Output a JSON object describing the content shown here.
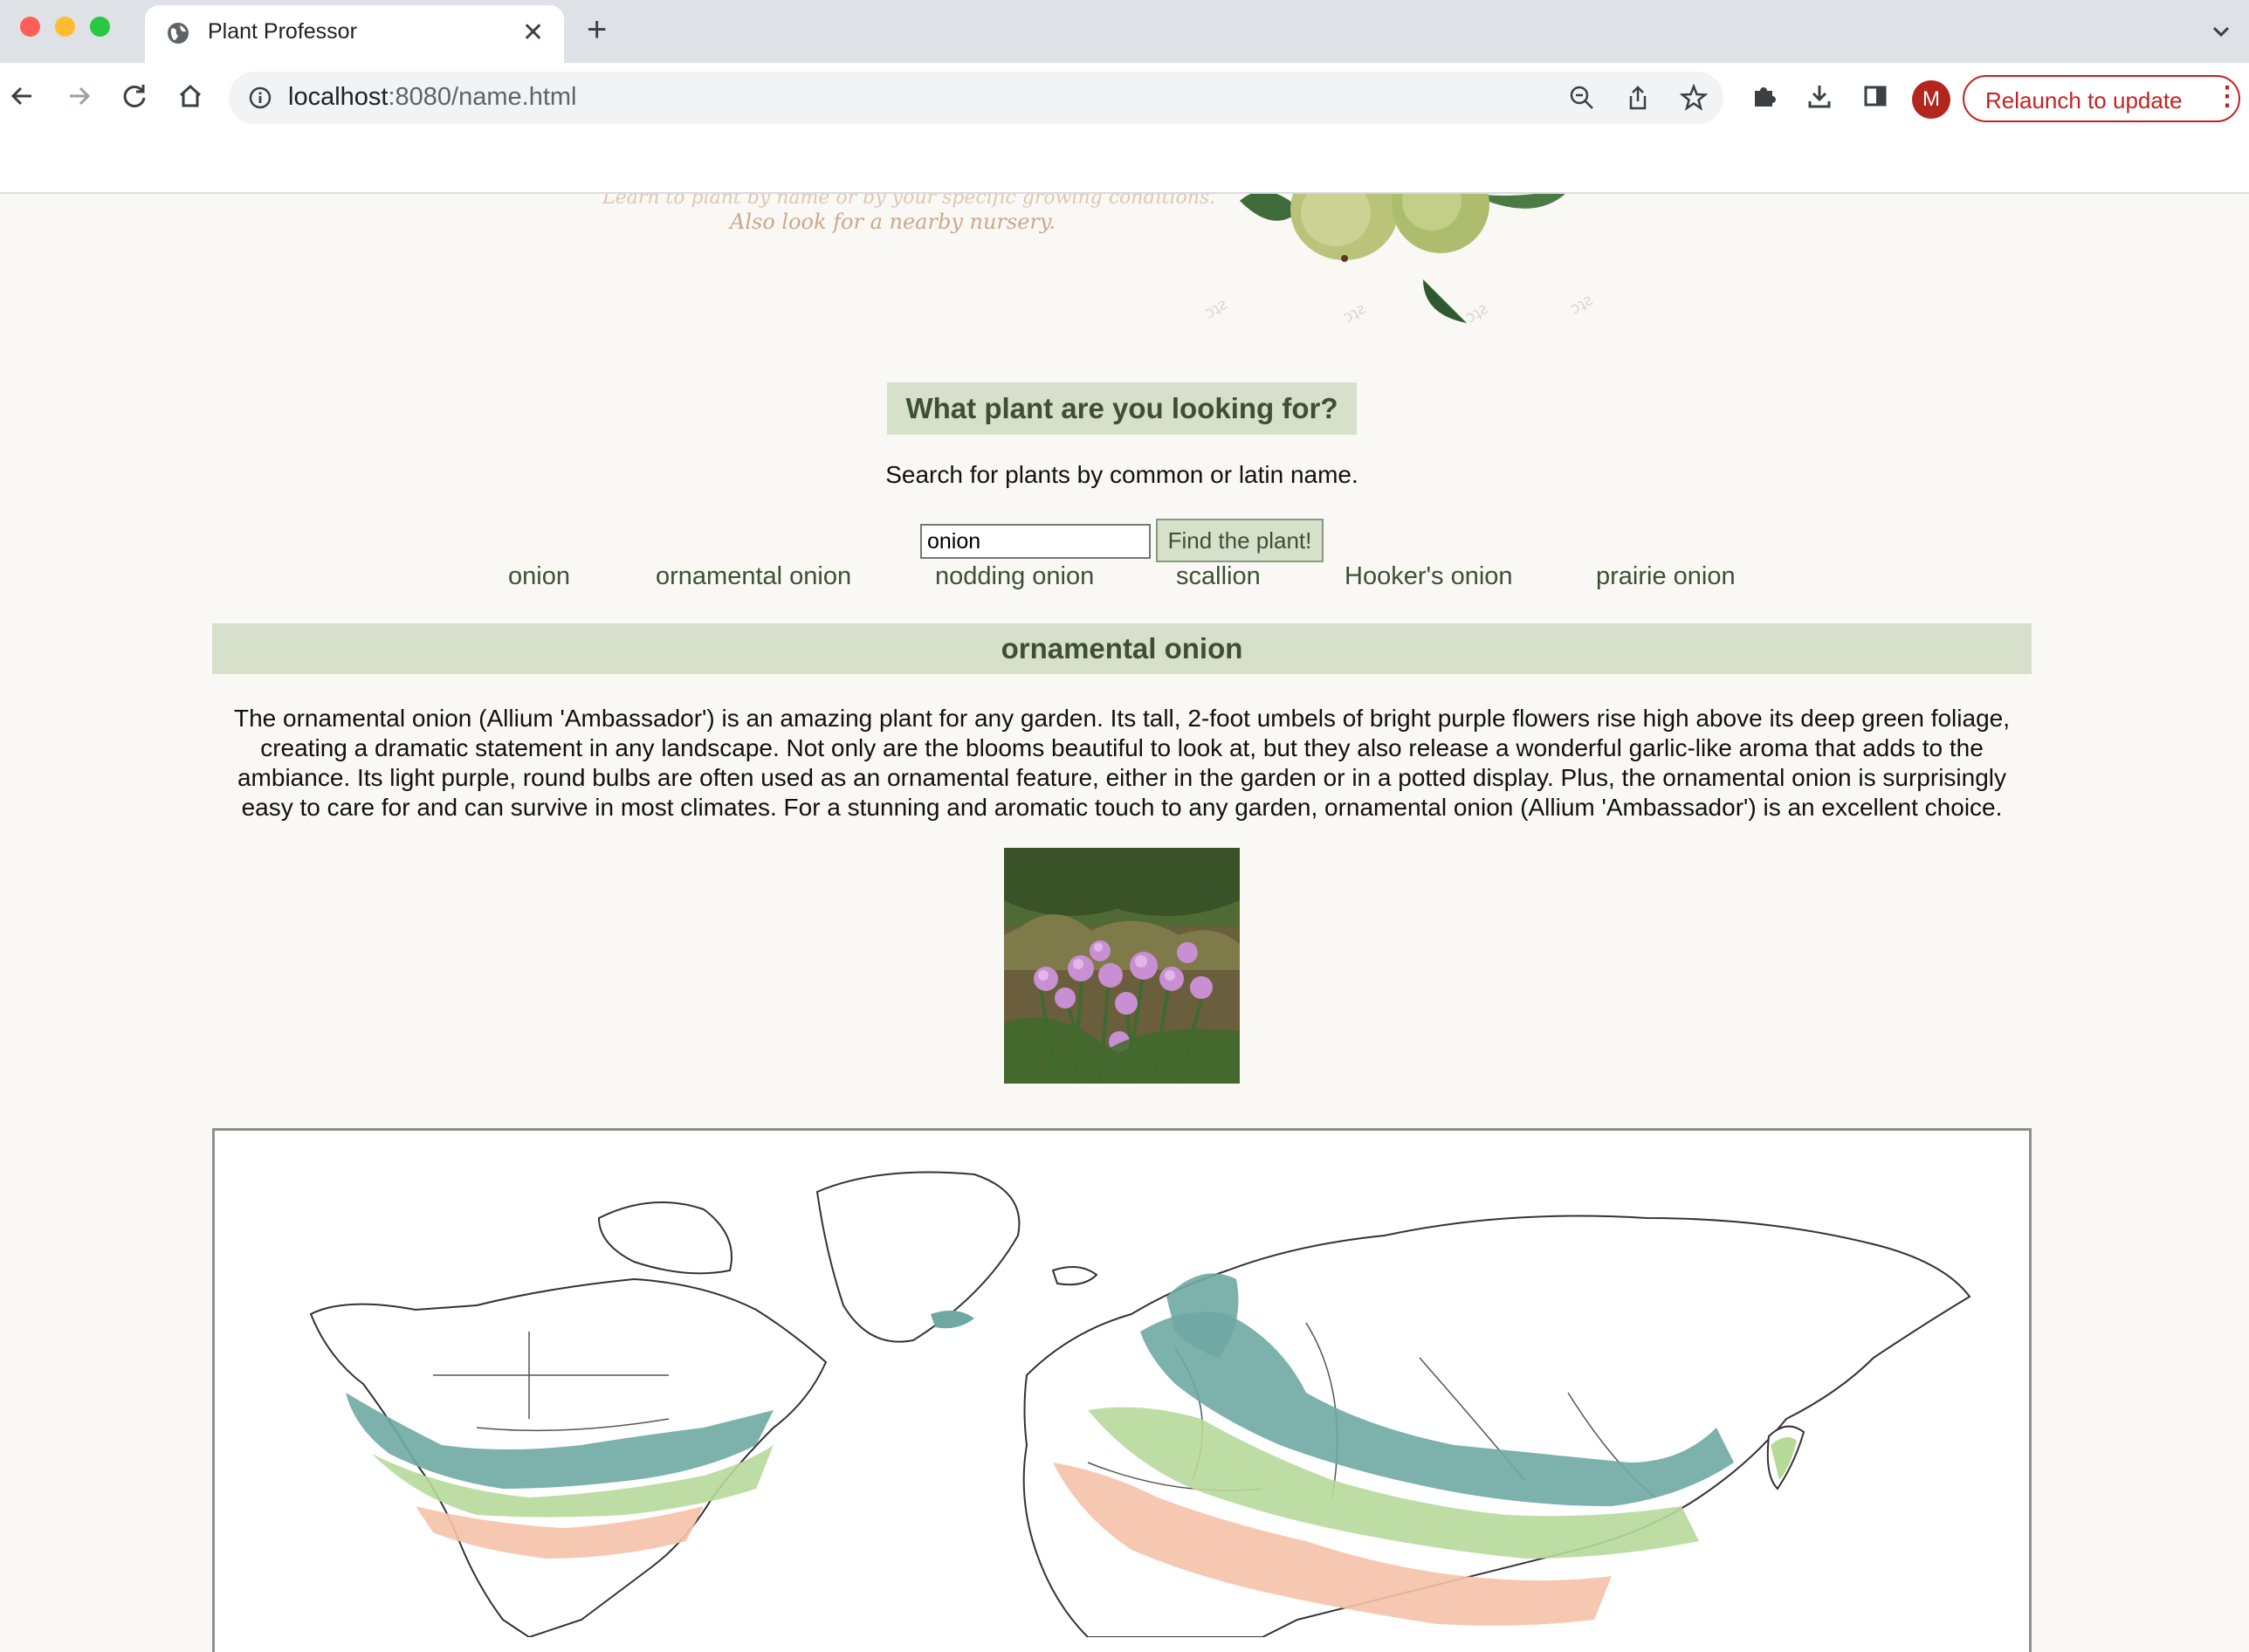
{
  "browser": {
    "tab_title": "Plant Professor",
    "url_host": "localhost",
    "url_rest": ":8080/name.html",
    "profile_initial": "M",
    "relaunch_label": "Relaunch to update"
  },
  "hero": {
    "tagline_partial": "Learn to plant by name or by your specific growing conditions.",
    "tagline_nursery": "Also look for a nearby nursery."
  },
  "search": {
    "question": "What plant are you looking for?",
    "instructions": "Search for plants by common or latin name.",
    "query": "onion",
    "button_label": "Find the plant!",
    "results": [
      "onion",
      "ornamental onion",
      "nodding onion",
      "scallion",
      "Hooker's onion",
      "prairie onion"
    ]
  },
  "plant": {
    "name": "ornamental onion",
    "description": "The ornamental onion (Allium 'Ambassador') is an amazing plant for any garden. Its tall, 2-foot umbels of bright purple flowers rise high above its deep green foliage, creating a dramatic statement in any landscape. Not only are the blooms beautiful to look at, but they also release a wonderful garlic-like aroma that adds to the ambiance. Its light purple, round bulbs are often used as an ornamental feature, either in the garden or in a potted display. Plus, the ornamental onion is surprisingly easy to care for and can survive in most climates. For a stunning and aromatic touch to any garden, ornamental onion (Allium 'Ambassador') is an excellent choice."
  },
  "colors": {
    "accent_bg": "#d6e0cb",
    "accent_text": "#3e4f37",
    "page_bg": "#f9f8f4",
    "zone_teal": "#6fa8a3",
    "zone_green": "#b7d99a",
    "zone_peach": "#f6c2a8"
  }
}
